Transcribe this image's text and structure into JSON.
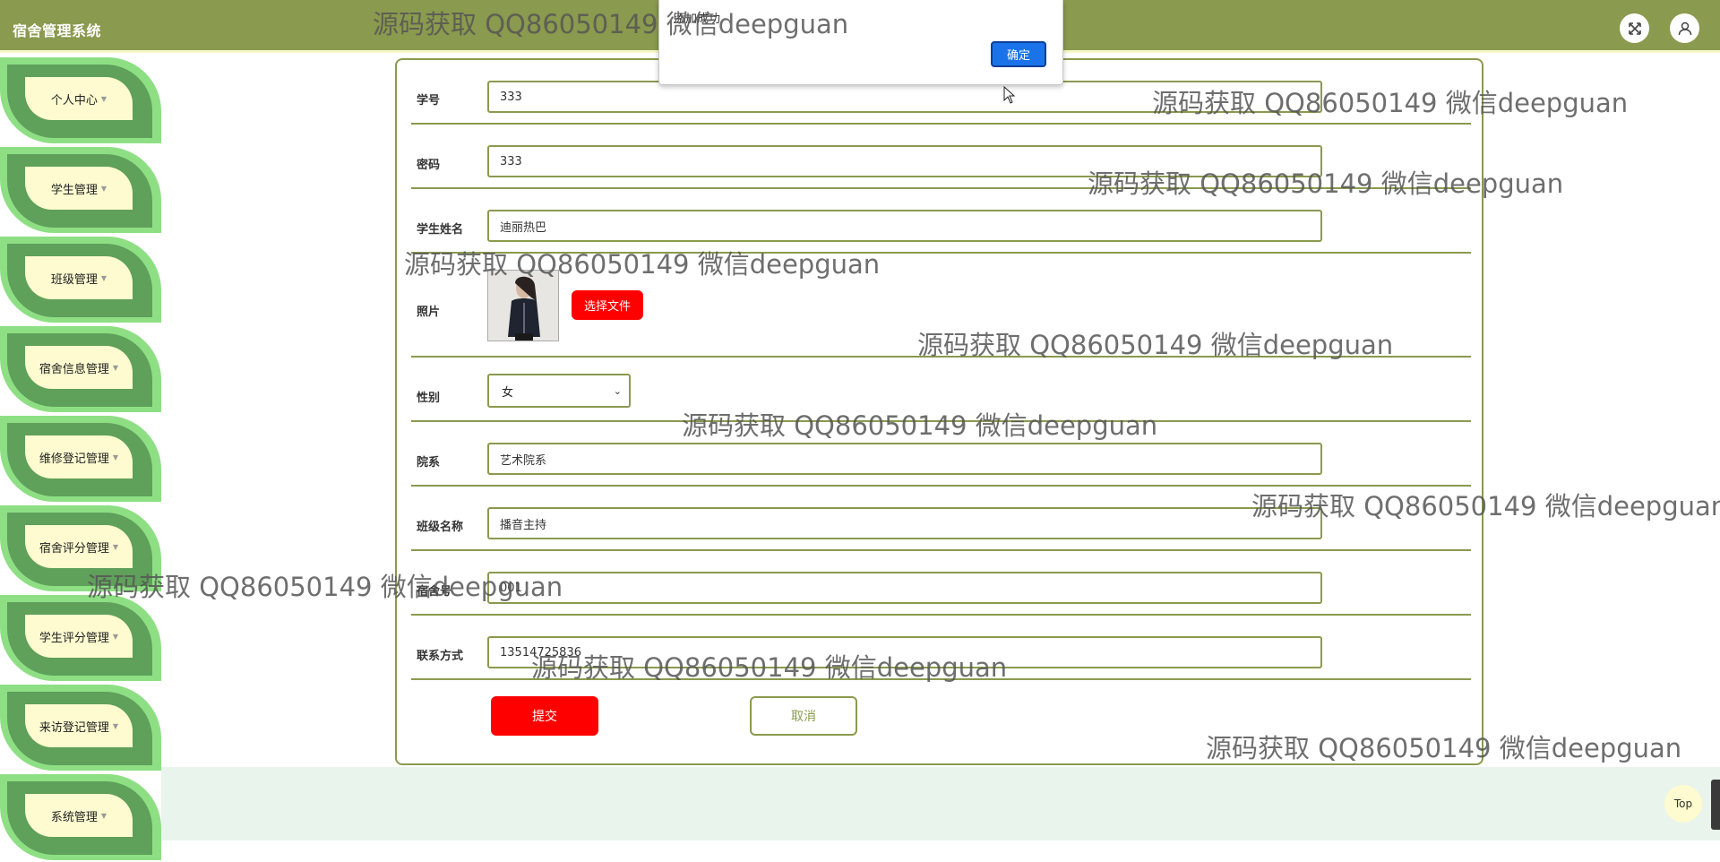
{
  "app": {
    "title": "宿舍管理系统"
  },
  "header": {
    "fullscreen_icon": "expand-icon",
    "user_icon": "user-icon"
  },
  "sidebar": {
    "items": [
      {
        "label": "个人中心"
      },
      {
        "label": "学生管理"
      },
      {
        "label": "班级管理"
      },
      {
        "label": "宿舍信息管理"
      },
      {
        "label": "维修登记管理"
      },
      {
        "label": "宿舍评分管理"
      },
      {
        "label": "学生评分管理"
      },
      {
        "label": "来访登记管理"
      },
      {
        "label": "系统管理"
      }
    ]
  },
  "form": {
    "fields": {
      "student_no": {
        "label": "学号",
        "value": "333"
      },
      "password": {
        "label": "密码",
        "value": "333"
      },
      "name": {
        "label": "学生姓名",
        "value": "迪丽热巴"
      },
      "photo": {
        "label": "照片",
        "button": "选择文件"
      },
      "gender": {
        "label": "性别",
        "value": "女"
      },
      "department": {
        "label": "院系",
        "value": "艺术院系"
      },
      "class_name": {
        "label": "班级名称",
        "value": "播音主持"
      },
      "dorm_no": {
        "label": "宿舍号",
        "value": "001"
      },
      "contact": {
        "label": "联系方式",
        "value": "13514725836"
      }
    },
    "submit": "提交",
    "cancel": "取消"
  },
  "dialog": {
    "message": "添加成功",
    "ok": "确定"
  },
  "watermark": "源码获取 QQ86050149 微信deepguan",
  "back_to_top": "Top",
  "colors": {
    "primary": "#8a9a4e",
    "accent": "#ff0000",
    "leaf_light": "#8edf84",
    "leaf_dark": "#5fa05a",
    "cream": "#fdfbcf"
  }
}
